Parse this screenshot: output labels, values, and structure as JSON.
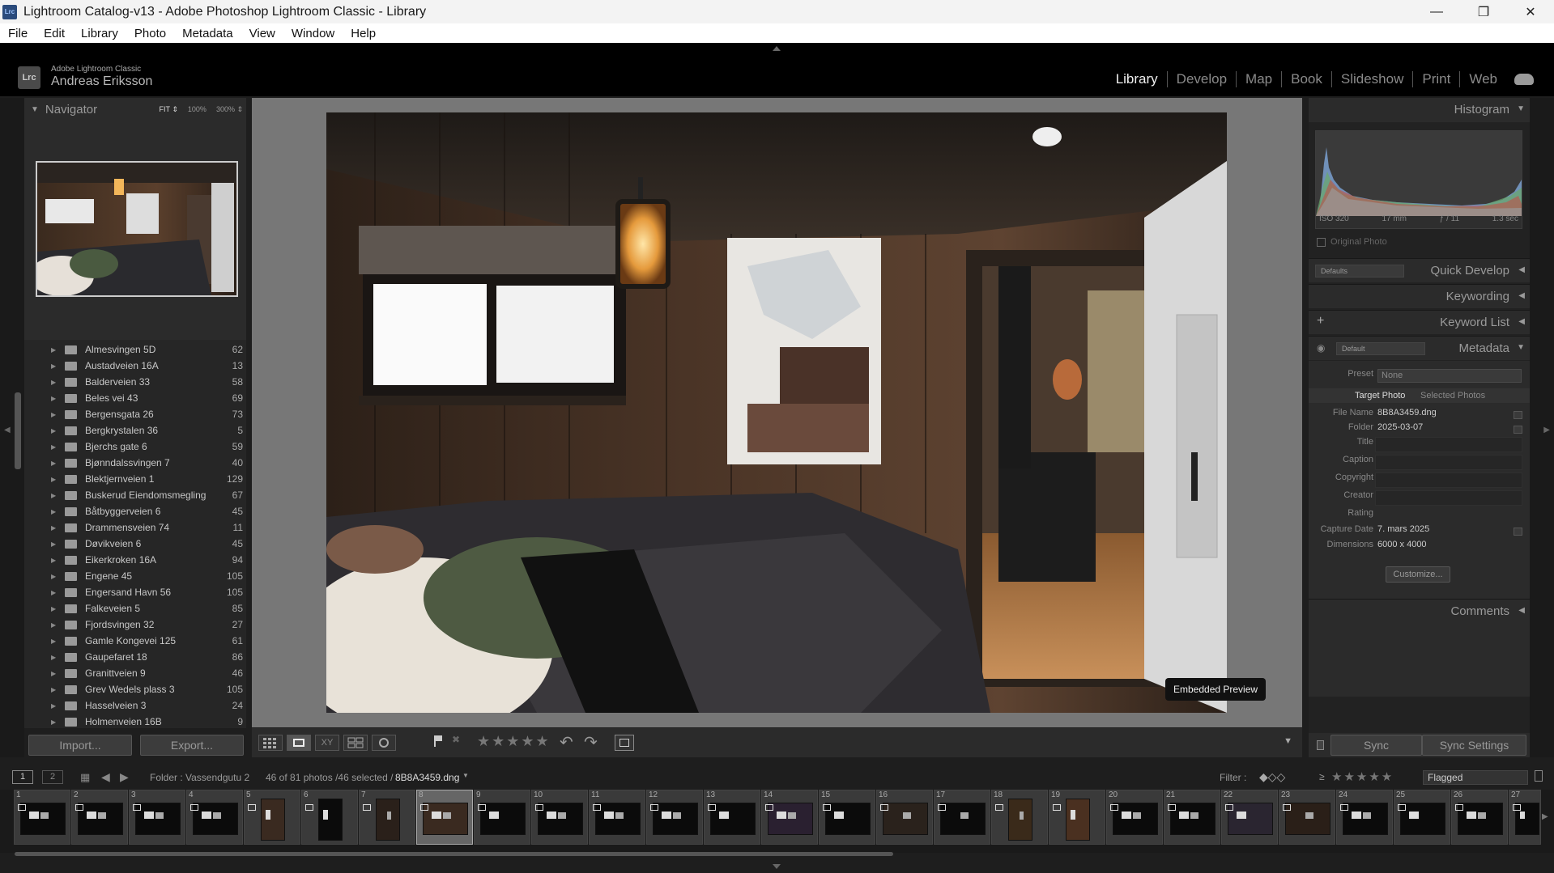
{
  "window": {
    "title": "Lightroom Catalog-v13 - Adobe Photoshop Lightroom Classic - Library",
    "app_icon": "Lrc",
    "minimize": "—",
    "restore": "❐",
    "close": "✕"
  },
  "menu": [
    "File",
    "Edit",
    "Library",
    "Photo",
    "Metadata",
    "View",
    "Window",
    "Help"
  ],
  "identity": {
    "badge": "Lrc",
    "product": "Adobe Lightroom Classic",
    "user": "Andreas Eriksson"
  },
  "modules": [
    "Library",
    "Develop",
    "Map",
    "Book",
    "Slideshow",
    "Print",
    "Web"
  ],
  "navigator": {
    "title": "Navigator",
    "zoom_fit": "FIT ⇕",
    "zoom_100": "100%",
    "zoom_300": "300% ⇕"
  },
  "folders": [
    {
      "name": "Almesvingen 5D",
      "count": "62"
    },
    {
      "name": "Austadveien 16A",
      "count": "13"
    },
    {
      "name": "Balderveien 33",
      "count": "58"
    },
    {
      "name": "Beles vei 43",
      "count": "69"
    },
    {
      "name": "Bergensgata 26",
      "count": "73"
    },
    {
      "name": "Bergkrystalen 36",
      "count": "5"
    },
    {
      "name": "Bjerchs gate 6",
      "count": "59"
    },
    {
      "name": "Bjønndalssvingen 7",
      "count": "40"
    },
    {
      "name": "Blektjernveien 1",
      "count": "129"
    },
    {
      "name": "Buskerud Eiendomsmegling",
      "count": "67"
    },
    {
      "name": "Båtbyggerveien 6",
      "count": "45"
    },
    {
      "name": "Drammensveien 74",
      "count": "11"
    },
    {
      "name": "Døvikveien 6",
      "count": "45"
    },
    {
      "name": "Eikerkroken 16A",
      "count": "94"
    },
    {
      "name": "Engene 45",
      "count": "105"
    },
    {
      "name": "Engersand Havn 56",
      "count": "105"
    },
    {
      "name": "Falkeveien 5",
      "count": "85"
    },
    {
      "name": "Fjordsvingen 32",
      "count": "27"
    },
    {
      "name": "Gamle Kongevei 125",
      "count": "61"
    },
    {
      "name": "Gaupefaret 18",
      "count": "86"
    },
    {
      "name": "Granittveien 9",
      "count": "46"
    },
    {
      "name": "Grev Wedels plass 3",
      "count": "105"
    },
    {
      "name": "Hasselveien 3",
      "count": "24"
    },
    {
      "name": "Holmenveien 16B",
      "count": "9"
    }
  ],
  "left_buttons": {
    "import": "Import...",
    "export": "Export..."
  },
  "viewer": {
    "badge": "Embedded Preview"
  },
  "toolbar": {
    "stars": "★★★★★"
  },
  "histogram": {
    "title": "Histogram",
    "iso": "ISO 320",
    "focal": "17 mm",
    "aperture": "ƒ / 11",
    "shutter": "1.3 sec",
    "original_photo": "Original Photo"
  },
  "quick_develop": {
    "title": "Quick Develop",
    "preset": "Defaults"
  },
  "keywording": {
    "title": "Keywording"
  },
  "keyword_list": {
    "title": "Keyword List",
    "plus": "+"
  },
  "metadata": {
    "title": "Metadata",
    "preset_select": "Default",
    "preset_label": "Preset",
    "preset_value": "None",
    "tab_target": "Target Photo",
    "tab_selected": "Selected Photos",
    "fields": [
      {
        "label": "File Name",
        "value": "8B8A3459.dng"
      },
      {
        "label": "Folder",
        "value": "2025-03-07"
      },
      {
        "label": "Title",
        "value": ""
      },
      {
        "label": "Caption",
        "value": ""
      },
      {
        "label": "Copyright",
        "value": ""
      },
      {
        "label": "Creator",
        "value": ""
      },
      {
        "label": "Rating",
        "value": ""
      },
      {
        "label": "Capture Date",
        "value": "7. mars 2025"
      },
      {
        "label": "Dimensions",
        "value": "6000 x 4000"
      }
    ],
    "customize": "Customize..."
  },
  "comments": {
    "title": "Comments"
  },
  "right_buttons": {
    "sync": "Sync",
    "sync_settings": "Sync Settings"
  },
  "filmbar": {
    "screen1": "1",
    "screen2": "2",
    "source": "Folder : Vassendgutu 2",
    "count": "46 of 81 photos /46 selected /",
    "filename": "8B8A3459.dng",
    "filter_label": "Filter :",
    "ge": "≥",
    "stars": "★★★★★",
    "filter_value": "Flagged"
  },
  "filmstrip": [
    {
      "n": "1"
    },
    {
      "n": "2"
    },
    {
      "n": "3"
    },
    {
      "n": "4"
    },
    {
      "n": "5"
    },
    {
      "n": "6"
    },
    {
      "n": "7"
    },
    {
      "n": "8"
    },
    {
      "n": "9"
    },
    {
      "n": "10"
    },
    {
      "n": "11"
    },
    {
      "n": "12"
    },
    {
      "n": "13"
    },
    {
      "n": "14"
    },
    {
      "n": "15"
    },
    {
      "n": "16"
    },
    {
      "n": "17"
    },
    {
      "n": "18"
    },
    {
      "n": "19"
    },
    {
      "n": "20"
    },
    {
      "n": "21"
    },
    {
      "n": "22"
    },
    {
      "n": "23"
    },
    {
      "n": "24"
    },
    {
      "n": "25"
    },
    {
      "n": "26"
    },
    {
      "n": "27"
    }
  ]
}
